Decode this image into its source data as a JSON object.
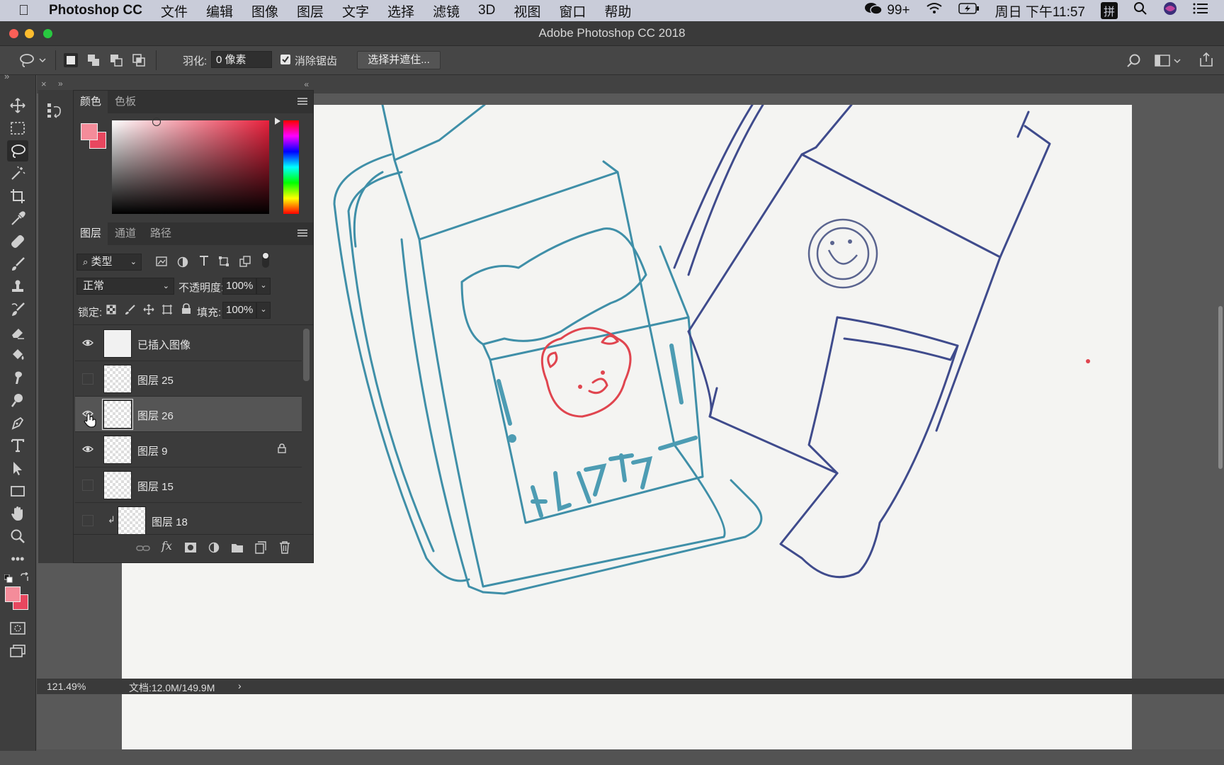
{
  "menubar": {
    "app_name": "Photoshop CC",
    "items": [
      "文件",
      "编辑",
      "图像",
      "图层",
      "文字",
      "选择",
      "滤镜",
      "3D",
      "视图",
      "窗口",
      "帮助"
    ],
    "notification_count": "99+",
    "clock": "周日 下午11:57",
    "input_method": "拼"
  },
  "window": {
    "title": "Adobe Photoshop CC 2018"
  },
  "options_bar": {
    "feather_label": "羽化:",
    "feather_value": "0 像素",
    "antialias_label": "消除锯齿",
    "antialias_checked": true,
    "select_mask_button": "选择并遮住..."
  },
  "color_panel": {
    "tabs": [
      "颜色",
      "色板"
    ],
    "active_tab": "颜色",
    "foreground_color": "#f48c9a",
    "background_color": "#e8475f",
    "hue_color": "#e8203c"
  },
  "layers_panel": {
    "tabs": [
      "图层",
      "通道",
      "路径"
    ],
    "active_tab": "图层",
    "filter_type": "类型",
    "blend_mode": "正常",
    "opacity_label": "不透明度:",
    "opacity_value": "100%",
    "lock_label": "锁定:",
    "fill_label": "填充:",
    "fill_value": "100%",
    "layers": [
      {
        "name": "已插入图像",
        "visible": true,
        "selected": false,
        "locked": false,
        "clipped": false
      },
      {
        "name": "图层 25",
        "visible": false,
        "selected": false,
        "locked": false,
        "clipped": false
      },
      {
        "name": "图层 26",
        "visible": true,
        "selected": true,
        "locked": false,
        "clipped": false
      },
      {
        "name": "图层 9",
        "visible": true,
        "selected": false,
        "locked": true,
        "clipped": false
      },
      {
        "name": "图层 15",
        "visible": false,
        "selected": false,
        "locked": false,
        "clipped": false
      },
      {
        "name": "图层 18",
        "visible": false,
        "selected": false,
        "locked": false,
        "clipped": true
      }
    ]
  },
  "toolbar": {
    "active_tool": "lasso-tool",
    "tools": [
      "move-tool",
      "marquee-tool",
      "lasso-tool",
      "magic-wand-tool",
      "crop-tool",
      "eyedropper-tool",
      "healing-brush-tool",
      "brush-tool",
      "clone-stamp-tool",
      "history-brush-tool",
      "eraser-tool",
      "paint-bucket-tool",
      "smudge-tool",
      "dodge-tool",
      "pen-tool",
      "type-tool",
      "path-selection-tool",
      "rectangle-tool",
      "hand-tool",
      "zoom-tool",
      "more-tools"
    ]
  },
  "canvas": {
    "label_text": "ミルクティー"
  },
  "status_bar": {
    "zoom": "121.49%",
    "doc_size": "文档:12.0M/149.9M"
  }
}
